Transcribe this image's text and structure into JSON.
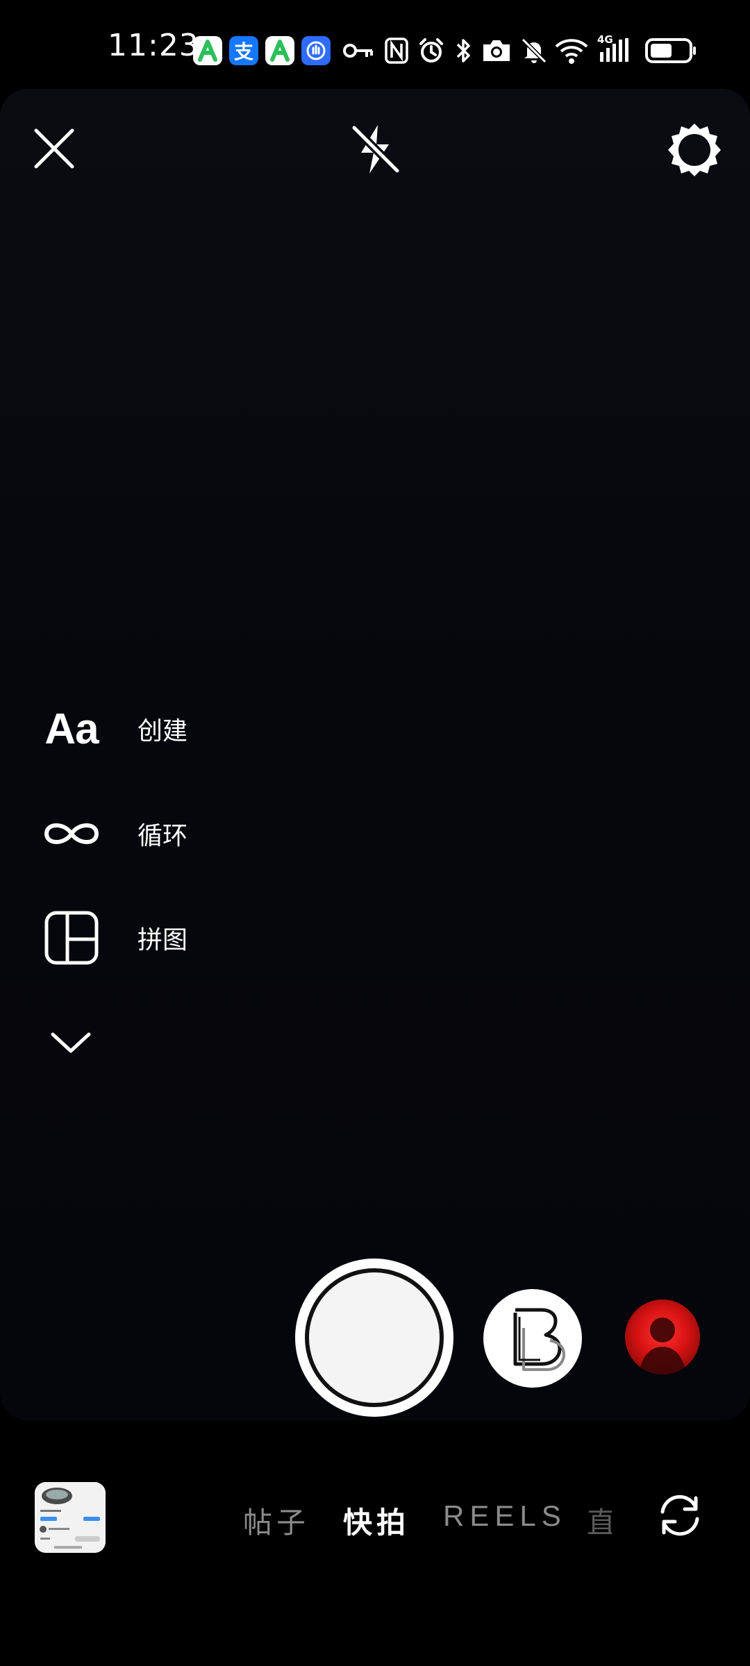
{
  "status_bar": {
    "time": "11:23",
    "notification_apps": [
      "app-a-green-icon",
      "alipay-icon",
      "app-a-green-icon",
      "app-hand-blue-icon"
    ],
    "alipay_glyph": "支",
    "system_icons": [
      "key-icon",
      "nfc-icon",
      "alarm-icon",
      "bluetooth-icon",
      "camera-icon",
      "mute-icon",
      "wifi-icon",
      "4g-signal-icon",
      "battery-icon"
    ],
    "network": "4G"
  },
  "top_controls": {
    "close": "close-icon",
    "flash": "flash-off-icon",
    "settings": "gear-icon"
  },
  "tools": {
    "create": {
      "icon_text": "Aa",
      "label": "创建"
    },
    "loop": {
      "icon": "infinity-icon",
      "label": "循环"
    },
    "collage": {
      "icon": "layout-grid-icon",
      "label": "拼图"
    },
    "more": {
      "icon": "chevron-down-icon"
    }
  },
  "capture": {
    "shutter": "shutter-button",
    "boomerang": "boomerang-icon",
    "effect_avatar": "red-portrait-effect"
  },
  "mode_tabs": {
    "post": "帖子",
    "story": "快拍",
    "reels": "REELS",
    "live": "直",
    "active": "快拍"
  },
  "colors": {
    "background": "#000000",
    "viewport": "#06070c",
    "active_tab": "#ffffff",
    "inactive_tab": "#8b8b8b",
    "avatar_red": "#d61212"
  }
}
